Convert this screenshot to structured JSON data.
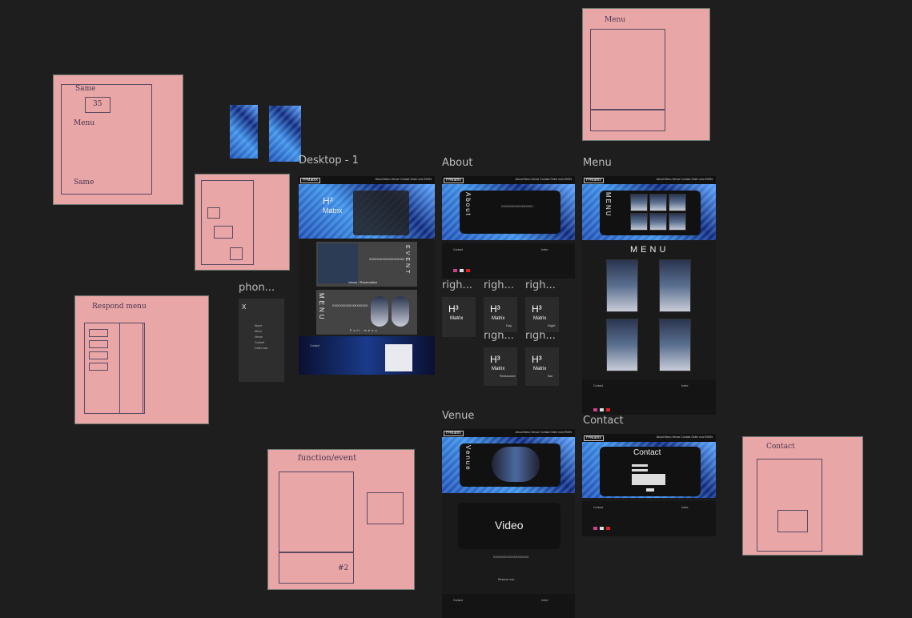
{
  "frames": {
    "desktop": "Desktop - 1",
    "about": "About",
    "menu": "Menu",
    "venue": "Venue",
    "contact": "Contact",
    "phone": "phon...",
    "righ": "righ..."
  },
  "nav": {
    "logo": "H³Matrix",
    "links": "About  Menu  Venue  Contact  Order now  ENG▾"
  },
  "desktop": {
    "brand_h": "H³",
    "brand_name": "Matrix",
    "event_word": "EVENT",
    "event_sub": "Venue / Reservation",
    "menu_word": "MENU",
    "full_menu": "Full menu",
    "body_text": "XXXXXXXXXXXXXXXXXXX"
  },
  "about": {
    "title": "About",
    "body_text": "XXXXXXXXXXXXXXXXX"
  },
  "menu_page": {
    "hero_word": "MENU",
    "heading": "MENU"
  },
  "venue": {
    "title": "Venue",
    "video": "Video",
    "reserve": "Reserve now"
  },
  "contact": {
    "title": "Contact"
  },
  "phone": {
    "close": "X",
    "items": [
      "About",
      "Menu",
      "Venue",
      "Contact",
      "Order now"
    ]
  },
  "cards": [
    {
      "h": "H³",
      "name": "Matrix",
      "sub": ""
    },
    {
      "h": "H³",
      "name": "Matrix",
      "sub": "Day"
    },
    {
      "h": "H³",
      "name": "Matrix",
      "sub": "Night"
    },
    {
      "h": "H³",
      "name": "Matrix",
      "sub": "Restaurant"
    },
    {
      "h": "H³",
      "name": "Matrix",
      "sub": "Bar"
    }
  ],
  "footer": {
    "label": "Contact",
    "links_label": "Index"
  },
  "notes": {
    "same": "Same",
    "qty": "35",
    "menu": "Menu",
    "same_bottom": "Same",
    "respond": "Respond menu",
    "function": "function/event",
    "contact": "Contact",
    "num2": "#2"
  },
  "colors": {
    "canvas": "#1e1e1e",
    "sticky_note": "#e9a6a7",
    "frame_dark": "#1a1a1a"
  }
}
